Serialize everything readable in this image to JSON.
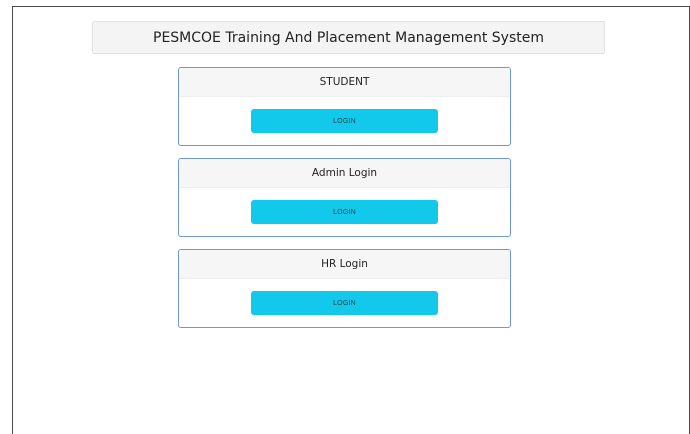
{
  "header": {
    "title": "PESMCOE Training And Placement Management System"
  },
  "cards": [
    {
      "title": "STUDENT",
      "button_label": "LOGIN"
    },
    {
      "title": "Admin Login",
      "button_label": "LOGIN"
    },
    {
      "title": "HR Login",
      "button_label": "LOGIN"
    }
  ],
  "colors": {
    "button": "#12c9ec",
    "card_border": "#6f96d9"
  }
}
